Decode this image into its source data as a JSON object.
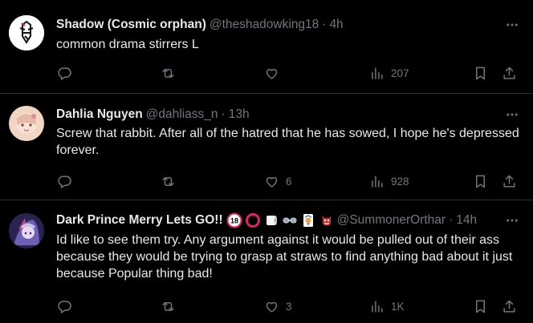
{
  "tweets": [
    {
      "name": "Shadow (Cosmic orphan)",
      "handle": "@theshadowking18",
      "separator": "·",
      "time": "4h",
      "text": "common drama stirrers L",
      "replies": "",
      "retweets": "",
      "likes": "",
      "views": "207"
    },
    {
      "name": "Dahlia Nguyen",
      "handle": "@dahliass_n",
      "separator": "·",
      "time": "13h",
      "text": "Screw that rabbit. After all of the hatred that he has sowed, I hope he's depressed forever.",
      "replies": "",
      "retweets": "",
      "likes": "6",
      "views": "928"
    },
    {
      "name": "Dark Prince Merry Lets GO!!",
      "handle": "@SummonerOrthar",
      "separator": "·",
      "time": "14h",
      "text": "Id like to see them try. Any argument against it would be pulled out of their ass because they would be trying to grasp at straws to find anything bad about it just because Popular thing bad!",
      "replies": "",
      "retweets": "",
      "likes": "3",
      "views": "1K"
    }
  ],
  "icons": {
    "reply": "reply-icon",
    "retweet": "retweet-icon",
    "like": "heart-icon",
    "views": "views-icon",
    "bookmark": "bookmark-icon",
    "share": "share-icon",
    "more": "more-icon"
  },
  "colors": {
    "background": "#000000",
    "text": "#e7e9ea",
    "muted": "#71767b",
    "divider": "#2f3336"
  }
}
